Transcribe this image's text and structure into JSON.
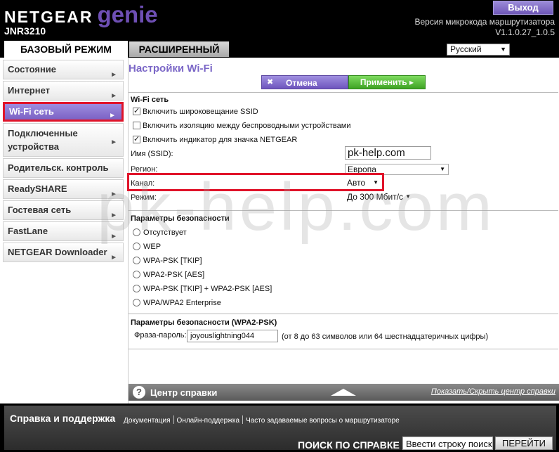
{
  "header": {
    "brand_main": "NETGEAR",
    "brand_genie": "genie",
    "model": "JNR3210",
    "logout_label": "Выход",
    "firmware_label": "Версия микрокода маршрутизатора",
    "firmware_version": "V1.1.0.27_1.0.5"
  },
  "tabs": {
    "basic": "БАЗОВЫЙ РЕЖИМ",
    "advanced": "РАСШИРЕННЫЙ"
  },
  "language": {
    "selected": "Русский"
  },
  "sidebar": {
    "items": [
      {
        "label": "Состояние"
      },
      {
        "label": "Интернет"
      },
      {
        "label": "Wi-Fi сеть"
      },
      {
        "label_line1": "Подключенные",
        "label_line2": "устройства"
      },
      {
        "label": "Родительск. контроль"
      },
      {
        "label": "ReadySHARE"
      },
      {
        "label": "Гостевая сеть"
      },
      {
        "label": "FastLane"
      },
      {
        "label": "NETGEAR Downloader"
      }
    ]
  },
  "main": {
    "title": "Настройки Wi-Fi",
    "cancel_label": "Отмена",
    "apply_label": "Применить",
    "wifi_section": "Wi-Fi сеть",
    "checkboxes": [
      {
        "label": "Включить широковещание SSID",
        "checked": true
      },
      {
        "label": "Включить изоляцию между беспроводными устройствами",
        "checked": false
      },
      {
        "label": "Включить индикатор для значка NETGEAR",
        "checked": true
      }
    ],
    "ssid_label": "Имя (SSID):",
    "ssid_value": "pk-help.com",
    "region_label": "Регион:",
    "region_value": "Европа",
    "channel_label": "Канал:",
    "channel_value": "Авто",
    "mode_label": "Режим:",
    "mode_value": "До 300 Мбит/с",
    "security_section": "Параметры безопасности",
    "security_options": [
      "Отсутствует",
      "WEP",
      "WPA-PSK [TKIP]",
      "WPA2-PSK [AES]",
      "WPA-PSK [TKIP] + WPA2-PSK [AES]",
      "WPA/WPA2 Enterprise"
    ],
    "psk_section": "Параметры безопасности (WPA2-PSK)",
    "passphrase_label": "Фраза-пароль:",
    "passphrase_value": "joyouslightning044",
    "passphrase_hint": "(от 8 до 63 символов или 64 шестнадцатеричных цифры)"
  },
  "helpbar": {
    "title": "Центр справки",
    "toggle_label": "Показать/Скрыть центр справки"
  },
  "footer": {
    "support_title": "Справка и поддержка",
    "links": [
      "Документация",
      "Онлайн-поддержка",
      "Часто задаваемые вопросы о маршрутизаторе"
    ],
    "search_label": "ПОИСК ПО СПРАВКЕ",
    "search_placeholder": "Ввести строку поиск",
    "search_button": "ПЕРЕЙТИ"
  },
  "watermark": "pk-help.com",
  "colors": {
    "accent_purple": "#7b62c4",
    "apply_green": "#3fa324",
    "highlight_red": "#e0142a"
  }
}
